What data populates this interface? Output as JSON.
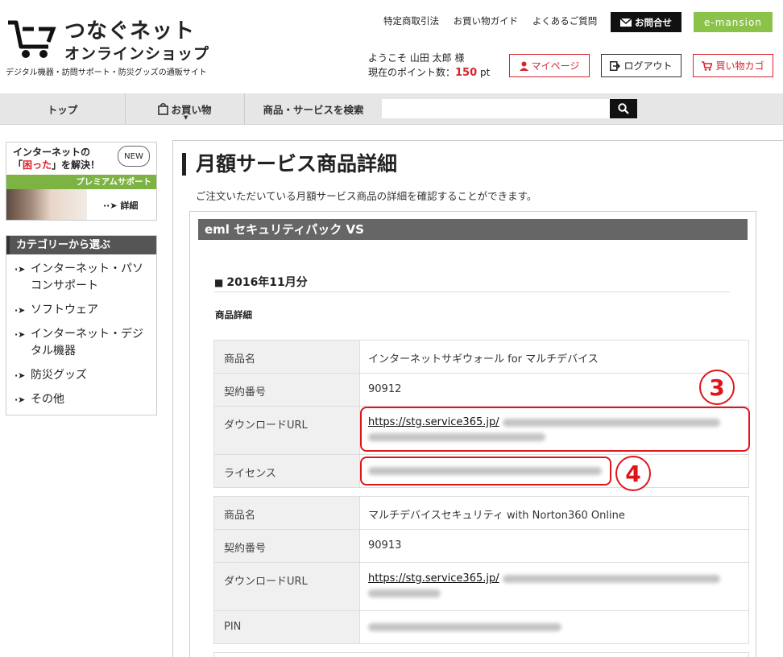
{
  "brand": {
    "name": "つなぐネット",
    "sub": "オンラインショップ",
    "tagline": "デジタル機器・訪問サポート・防災グッズの通販サイト"
  },
  "header_links": [
    "特定商取引法",
    "お買い物ガイド",
    "よくあるご質問"
  ],
  "contact_label": "お問合せ",
  "eml_label": "e-mansion",
  "welcome": {
    "greeting": "ようこそ 山田 太郎 様",
    "points_prefix": "現在のポイント数：",
    "points": "150",
    "points_unit": "pt"
  },
  "account_buttons": {
    "mypage": "マイページ",
    "logout": "ログアウト",
    "cart": "買い物カゴ"
  },
  "nav": {
    "top": "トップ",
    "shopping": "お買い物",
    "search_label": "商品・サービスを検索",
    "search_value": ""
  },
  "banner": {
    "line1": "インターネットの",
    "line2_open": "「",
    "line2_red": "困った",
    "line2_close": "」を解決！",
    "new": "NEW",
    "strip": "プレミアムサポート",
    "detail": "詳細"
  },
  "categories": {
    "heading": "カテゴリーから選ぶ",
    "items": [
      "インターネット・パソコンサポート",
      "ソフトウェア",
      "インターネット・デジタル機器",
      "防災グッズ",
      "その他"
    ]
  },
  "page": {
    "title": "月額サービス商品詳細",
    "description": "ご注文いただいている月額サービス商品の詳細を確認することができます。",
    "section_title": "eml セキュリティパック VS",
    "month": "2016年11月分",
    "detail_label": "商品詳細"
  },
  "products": [
    {
      "rows": [
        {
          "key": "商品名",
          "value": "インターネットサギウォール for マルチデバイス"
        },
        {
          "key": "契約番号",
          "value": "90912"
        },
        {
          "key": "ダウンロードURL",
          "value": "https://stg.service365.jp/"
        },
        {
          "key": "ライセンス",
          "value": ""
        }
      ]
    },
    {
      "rows": [
        {
          "key": "商品名",
          "value": "マルチデバイスセキュリティ with Norton360 Online"
        },
        {
          "key": "契約番号",
          "value": "90913"
        },
        {
          "key": "ダウンロードURL",
          "value": "https://stg.service365.jp/"
        },
        {
          "key": "PIN",
          "value": ""
        }
      ]
    }
  ],
  "annotations": {
    "first": "3",
    "second": "4",
    "color": "#e0151a"
  },
  "colors": {
    "accent_red": "#d9232e",
    "eml_green": "#8bc34a",
    "banner_green": "#7cb342",
    "section_gray": "#666666"
  }
}
